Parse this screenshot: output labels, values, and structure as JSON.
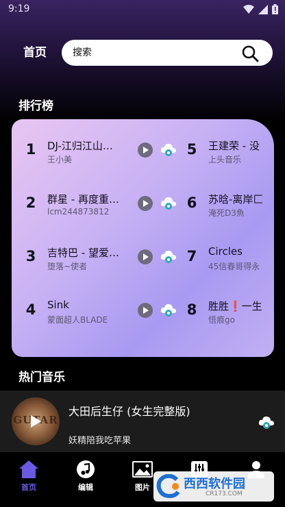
{
  "status_bar": {
    "time": "9:19"
  },
  "header": {
    "home_label": "首页",
    "search_placeholder": "搜索"
  },
  "ranking": {
    "title": "排行榜",
    "items": [
      {
        "rank": "1",
        "title": "DJ-江归江山…",
        "artist": "王小美"
      },
      {
        "rank": "2",
        "title": "群星 - 再度重…",
        "artist": "lcm244873812"
      },
      {
        "rank": "3",
        "title": "吉特巴 - 望爱…",
        "artist": "堕落~使者"
      },
      {
        "rank": "4",
        "title": "Sink",
        "artist": "蒙面超人BLADE"
      },
      {
        "rank": "5",
        "title": "王建荣 - 没",
        "artist": "上头音乐"
      },
      {
        "rank": "6",
        "title": "苏晗-离岸匚",
        "artist": "淹死D3魚"
      },
      {
        "rank": "7",
        "title": "Circles",
        "artist": "45信春哥得永"
      },
      {
        "rank": "8",
        "title": "胜胜❗一生",
        "artist": "悟痕go"
      }
    ]
  },
  "hot_music": {
    "title": "热门音乐"
  },
  "player": {
    "album_text": "GUTAR",
    "song_title": "大田后生仔 (女生完整版)",
    "artist": "妖精陪我吃苹果"
  },
  "nav": {
    "items": [
      {
        "label": "首页",
        "icon": "home-icon"
      },
      {
        "label": "编辑",
        "icon": "music-note-icon"
      },
      {
        "label": "图片",
        "icon": "image-icon"
      },
      {
        "label": "",
        "icon": "equalizer-icon"
      },
      {
        "label": "",
        "icon": "person-icon"
      }
    ],
    "active_index": 0
  },
  "watermark": {
    "main": "西西软件园",
    "sub": "CR173.COM"
  },
  "colors": {
    "accent": "#6a5ae0",
    "card_start": "#e9c6f2",
    "card_end": "#a89af2",
    "player_bg": "#1c1c1c"
  }
}
